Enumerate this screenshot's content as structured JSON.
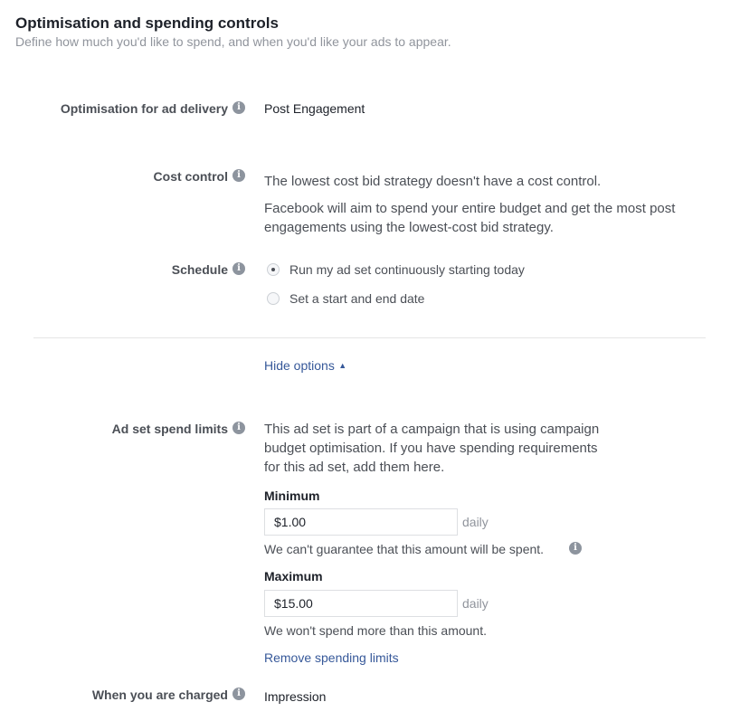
{
  "header": {
    "title": "Optimisation and spending controls",
    "subtitle": "Define how much you'd like to spend, and when you'd like your ads to appear."
  },
  "optimisation": {
    "label": "Optimisation for ad delivery",
    "value": "Post Engagement"
  },
  "cost_control": {
    "label": "Cost control",
    "line1": "The lowest cost bid strategy doesn't have a cost control.",
    "line2": "Facebook will aim to spend your entire budget and get the most post engagements using the lowest-cost bid strategy."
  },
  "schedule": {
    "label": "Schedule",
    "options": [
      {
        "label": "Run my ad set continuously starting today",
        "selected": true
      },
      {
        "label": "Set a start and end date",
        "selected": false
      }
    ]
  },
  "hide_options": "Hide options",
  "spend_limits": {
    "label": "Ad set spend limits",
    "description": "This ad set is part of a campaign that is using campaign budget optimisation. If you have spending requirements for this ad set, add them here.",
    "minimum_label": "Minimum",
    "minimum_value": "$1.00",
    "minimum_unit": "daily",
    "minimum_help": "We can't guarantee that this amount will be spent.",
    "maximum_label": "Maximum",
    "maximum_value": "$15.00",
    "maximum_unit": "daily",
    "maximum_help": "We won't spend more than this amount.",
    "remove_link": "Remove spending limits"
  },
  "charged": {
    "label": "When you are charged",
    "value": "Impression"
  },
  "icons": {
    "info": "i"
  }
}
